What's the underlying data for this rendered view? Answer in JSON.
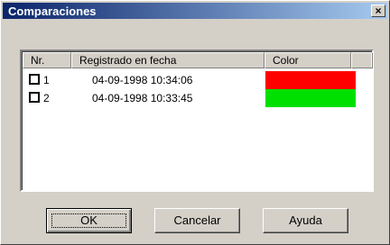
{
  "window": {
    "title": "Comparaciones",
    "close_glyph": "×"
  },
  "list": {
    "columns": [
      "Nr.",
      "Registrado en fecha",
      "Color"
    ],
    "rows": [
      {
        "nr": "1",
        "date": "04-09-1998 10:34:06",
        "color": "#ff0000"
      },
      {
        "nr": "2",
        "date": "04-09-1998 10:33:45",
        "color": "#00e000"
      }
    ]
  },
  "buttons": {
    "ok": "OK",
    "cancel": "Cancelar",
    "help": "Ayuda"
  }
}
